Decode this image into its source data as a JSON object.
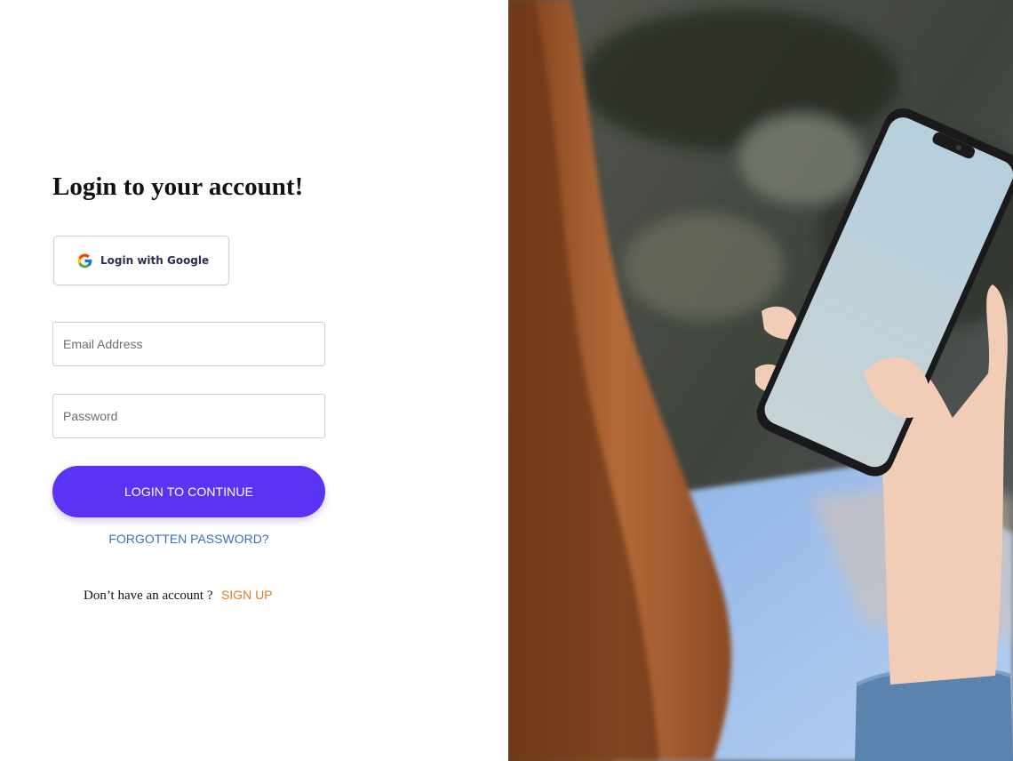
{
  "login": {
    "title": "Login to your account!",
    "google_button_label": "Login with Google",
    "email_placeholder": "Email Address",
    "password_placeholder": "Password",
    "submit_label": "LOGIN TO CONTINUE",
    "forgot_label": "FORGOTTEN PASSWORD?",
    "signup_prompt": "Don’t have an account ?",
    "signup_label": "SIGN UP"
  },
  "colors": {
    "primary": "#5b34f3",
    "link": "#3a6fb7",
    "signup": "#e07b23"
  },
  "icons": {
    "google": "google-g-icon"
  },
  "hero_image": {
    "subject": "woman-holding-smartphone-photo"
  }
}
